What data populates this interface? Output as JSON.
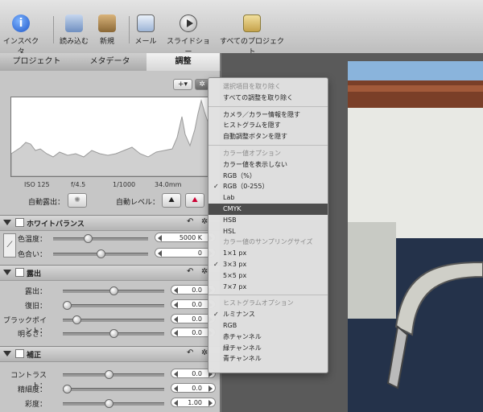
{
  "toolbar": {
    "inspector": "インスペクタ",
    "import": "読み込む",
    "new": "新規",
    "mail": "メール",
    "slideshow": "スライドショー",
    "all_projects": "すべてのプロジェクト"
  },
  "tabs": [
    "プロジェクト",
    "メタデータ",
    "調整"
  ],
  "exif": {
    "iso": "ISO 125",
    "aperture": "f/4.5",
    "shutter": "1/1000",
    "focal": "34.0mm"
  },
  "auto": {
    "exposure": "自動露出：",
    "levels": "自動レベル："
  },
  "sections": {
    "white_balance": {
      "title": "ホワイトバランス",
      "rows": [
        {
          "label": "色温度：",
          "value": "5000 K",
          "level": 0.35
        },
        {
          "label": "色合い：",
          "value": "0",
          "level": 0.5
        }
      ]
    },
    "exposure": {
      "title": "露出",
      "rows": [
        {
          "label": "露出：",
          "value": "0.0",
          "level": 0.5
        },
        {
          "label": "復旧：",
          "value": "0.0",
          "level": 0.0
        },
        {
          "label": "ブラックポイント：",
          "value": "0.0",
          "level": 0.1
        },
        {
          "label": "明るさ：",
          "value": "0.0",
          "level": 0.5
        }
      ]
    },
    "enhance": {
      "title": "補正",
      "rows": [
        {
          "label": "コントラスト：",
          "value": "0.0",
          "level": 0.45
        },
        {
          "label": "精細度：",
          "value": "0.0",
          "level": 0.0
        },
        {
          "label": "彩度：",
          "value": "1.00",
          "level": 0.45
        }
      ]
    }
  },
  "menu": {
    "items": [
      {
        "label": "選択項目を取り除く",
        "disabled": true
      },
      {
        "label": "すべての調整を取り除く"
      },
      {
        "sep": true
      },
      {
        "label": "カメラ／カラー情報を隠す"
      },
      {
        "label": "ヒストグラムを隠す"
      },
      {
        "label": "自動調整ボタンを隠す"
      },
      {
        "sep": true
      },
      {
        "label": "カラー値オプション",
        "disabled": true
      },
      {
        "label": "カラー値を表示しない"
      },
      {
        "label": "RGB（%）"
      },
      {
        "label": "RGB（0-255）",
        "checked": true
      },
      {
        "label": "Lab"
      },
      {
        "label": "CMYK",
        "highlighted": true
      },
      {
        "label": "HSB"
      },
      {
        "label": "HSL"
      },
      {
        "label": "カラー値のサンプリングサイズ",
        "disabled": true
      },
      {
        "label": "1×1 px"
      },
      {
        "label": "3×3 px",
        "checked": true
      },
      {
        "label": "5×5 px"
      },
      {
        "label": "7×7 px"
      },
      {
        "sep": true
      },
      {
        "label": "ヒストグラムオプション",
        "disabled": true
      },
      {
        "label": "ルミナンス",
        "checked": true
      },
      {
        "label": "RGB"
      },
      {
        "label": "赤チャンネル"
      },
      {
        "label": "緑チャンネル"
      },
      {
        "label": "青チャンネル"
      }
    ]
  },
  "colors": {
    "menu_highlight": "#4d4d4d",
    "sky": "#8ab4dc",
    "building": "#7a3f28"
  }
}
